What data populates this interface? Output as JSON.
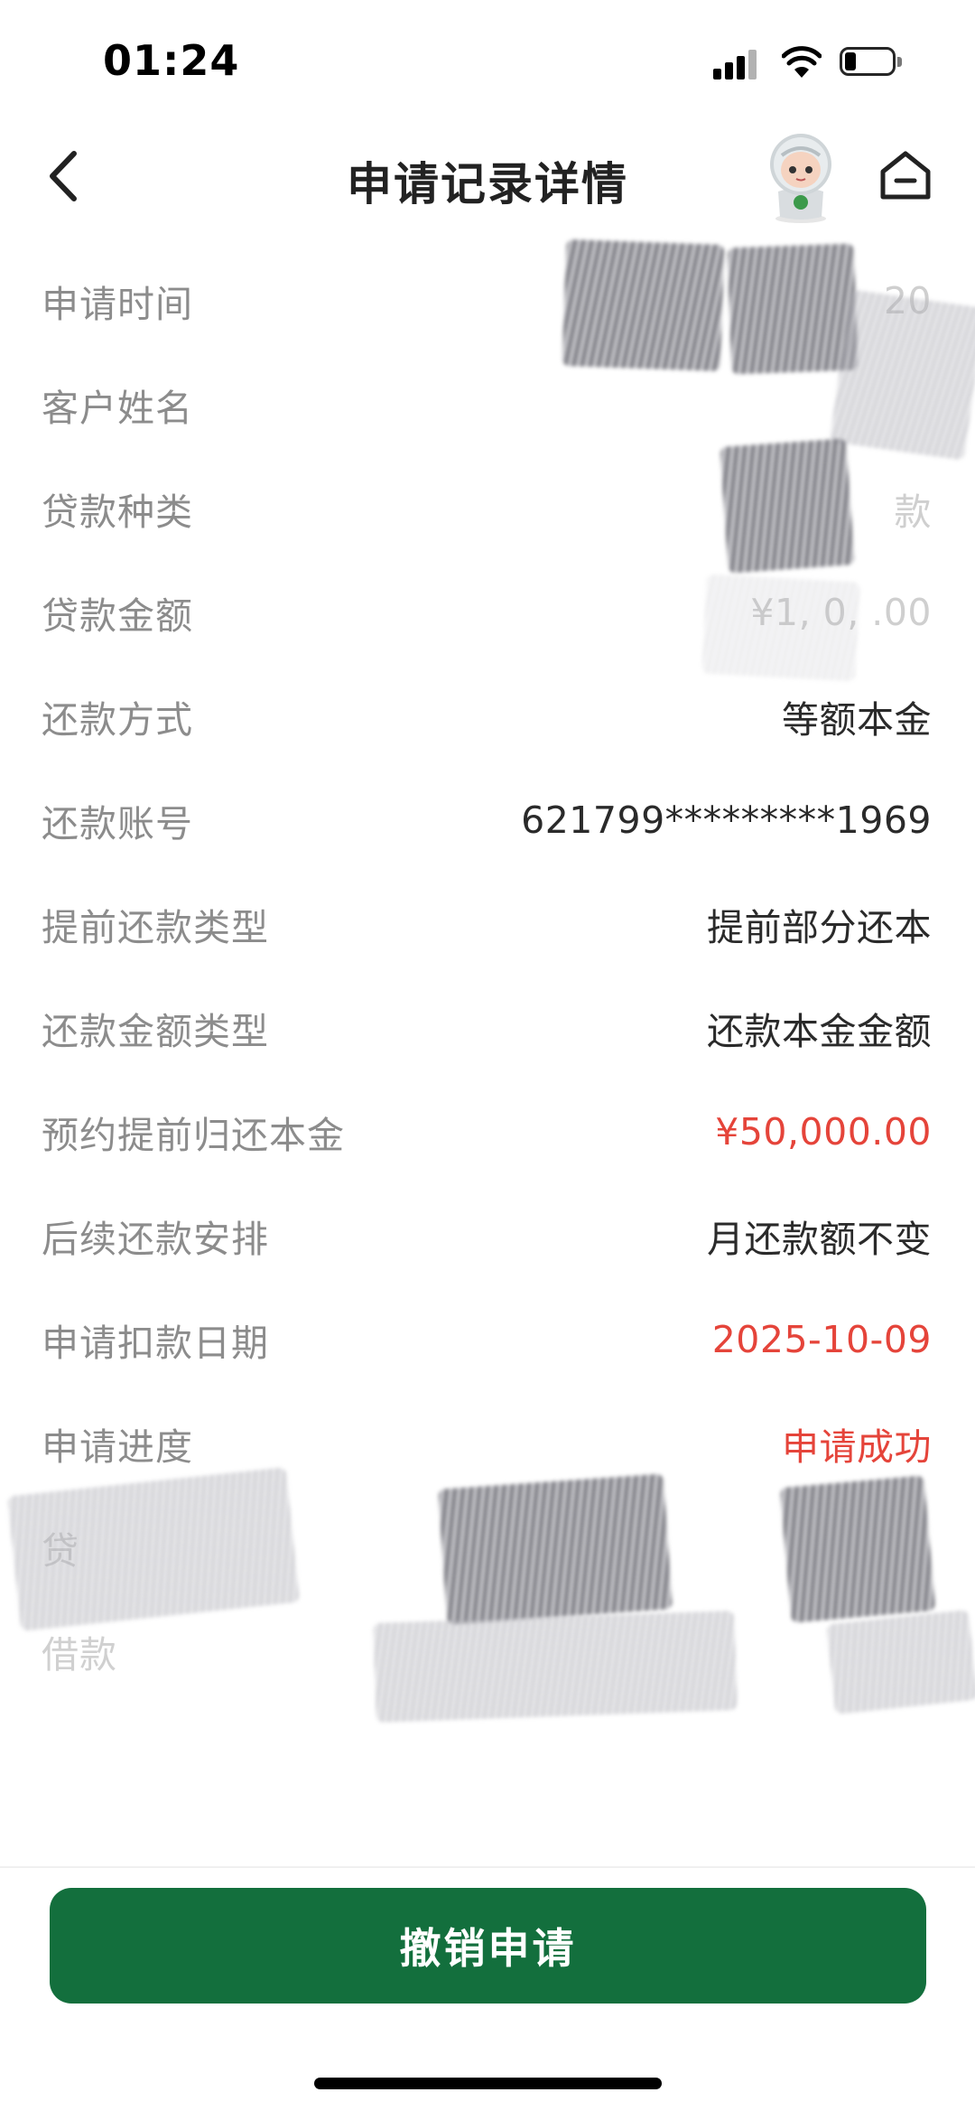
{
  "status_bar": {
    "time": "01:24",
    "battery_level": 0.2
  },
  "header": {
    "title": "申请记录详情",
    "back_icon": "chevron-left-icon",
    "assistant_icon": "robot-assistant-icon",
    "home_icon": "home-icon"
  },
  "details": [
    {
      "label": "申请时间",
      "value": "20",
      "redacted": true
    },
    {
      "label": "客户姓名",
      "value": "",
      "redacted": true
    },
    {
      "label": "贷款种类",
      "value": "款",
      "redacted": true
    },
    {
      "label": "贷款金额",
      "value": "¥1,  0,   .00",
      "redacted": true
    },
    {
      "label": "还款方式",
      "value": "等额本金"
    },
    {
      "label": "还款账号",
      "value": "621799*********1969"
    },
    {
      "label": "提前还款类型",
      "value": "提前部分还本"
    },
    {
      "label": "还款金额类型",
      "value": "还款本金金额"
    },
    {
      "label": "预约提前归还本金",
      "value": "¥50,000.00",
      "highlight": true
    },
    {
      "label": "后续还款安排",
      "value": "月还款额不变"
    },
    {
      "label": "申请扣款日期",
      "value": "2025-10-09",
      "highlight": true
    },
    {
      "label": "申请进度",
      "value": "申请成功",
      "highlight": true
    },
    {
      "label": "贷",
      "value": "",
      "redacted": true
    },
    {
      "label": "借款",
      "value": "",
      "redacted": true
    }
  ],
  "footer": {
    "revoke_button_label": "撤销申请"
  },
  "colors": {
    "primary_green": "#136f3d",
    "highlight_red": "#e5443a",
    "label_gray": "#8c8c8c"
  }
}
